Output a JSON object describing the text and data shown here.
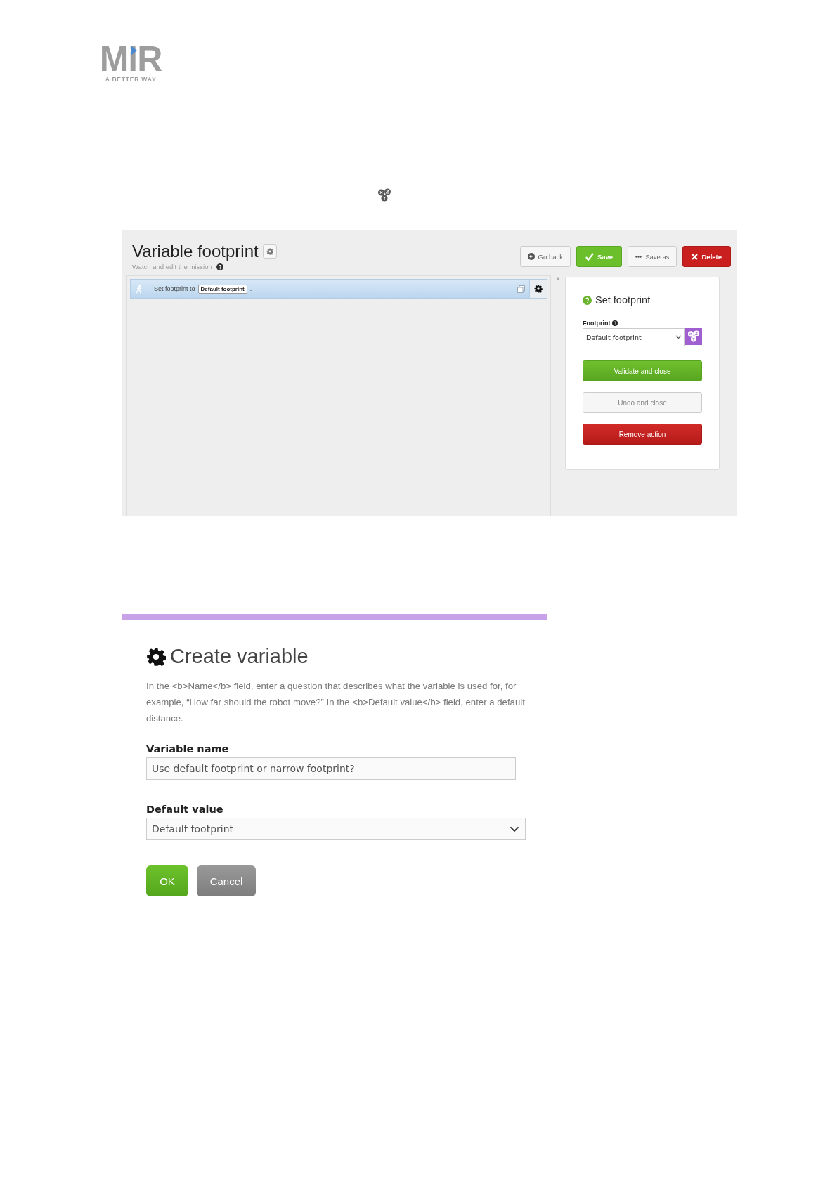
{
  "logo": {
    "wordmark": "MiR",
    "tagline": "A BETTER WAY"
  },
  "mission_editor": {
    "title": "Variable footprint",
    "subtitle": "Watch and edit the mission",
    "buttons": [
      {
        "label": "Go back",
        "kind": "back"
      },
      {
        "label": "Save",
        "kind": "save"
      },
      {
        "label": "Save as",
        "kind": "saveas"
      },
      {
        "label": "Delete",
        "kind": "delete"
      }
    ],
    "actions": [
      {
        "text": "Set footprint to",
        "value": "Default footprint",
        "suffix": "."
      }
    ],
    "panel": {
      "title": "Set footprint",
      "field_label": "Footprint",
      "select_value": "Default footprint",
      "buttons": [
        {
          "label": "Validate and close",
          "kind": "primary"
        },
        {
          "label": "Undo and close",
          "kind": "neutral"
        },
        {
          "label": "Remove action",
          "kind": "danger"
        }
      ]
    }
  },
  "create_variable": {
    "title": "Create variable",
    "description": "In the <b>Name</b> field, enter a question that describes what the variable is used for, for example, “How far should the robot move?” In the <b>Default value</b> field, enter a default distance.",
    "fields": [
      {
        "label": "Variable name",
        "value": "Use default footprint or narrow footprint?",
        "kind": "text"
      },
      {
        "label": "Default value",
        "value": "Default footprint",
        "kind": "select"
      }
    ],
    "buttons": [
      {
        "label": "OK",
        "kind": "ok"
      },
      {
        "label": "Cancel",
        "kind": "cancel"
      }
    ]
  }
}
